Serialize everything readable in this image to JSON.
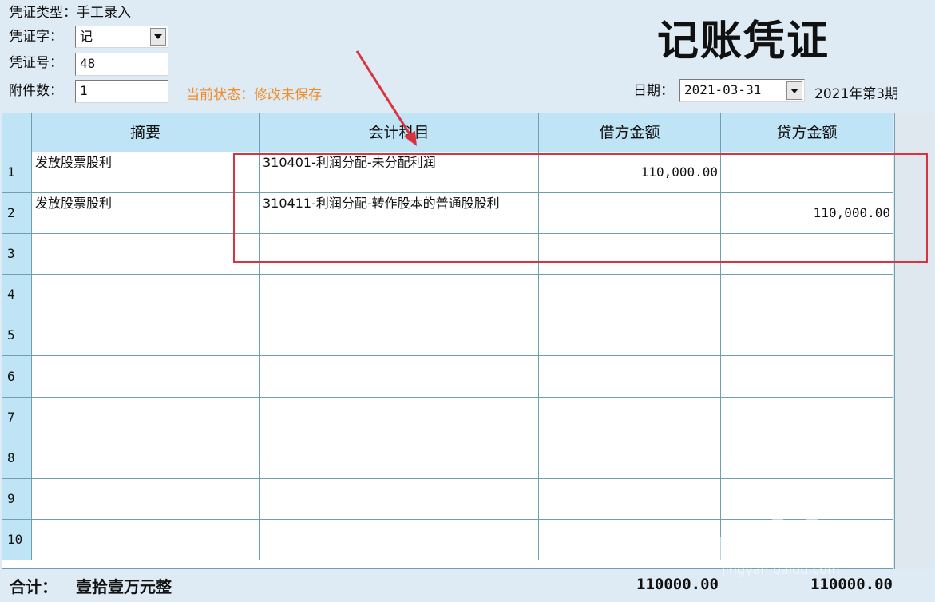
{
  "header": {
    "voucher_type_label": "凭证类型：",
    "voucher_type_value": "手工录入",
    "voucher_word_label": "凭证字：",
    "voucher_word_value": "记",
    "voucher_no_label": "凭证号：",
    "voucher_no_value": "48",
    "attachments_label": "附件数：",
    "attachments_value": "1",
    "status_text": "当前状态：修改未保存",
    "title": "记账凭证",
    "date_label": "日期：",
    "date_value": "2021-03-31",
    "period_text": "2021年第3期"
  },
  "table": {
    "columns": [
      "摘要",
      "会计科目",
      "借方金额",
      "贷方金额"
    ],
    "rows": [
      {
        "index": "1",
        "summary": "发放股票股利",
        "account": "310401-利润分配-未分配利润",
        "debit": "110,000.00",
        "credit": ""
      },
      {
        "index": "2",
        "summary": "发放股票股利",
        "account": "310411-利润分配-转作股本的普通股股利",
        "debit": "",
        "credit": "110,000.00"
      },
      {
        "index": "3",
        "summary": "",
        "account": "",
        "debit": "",
        "credit": ""
      },
      {
        "index": "4",
        "summary": "",
        "account": "",
        "debit": "",
        "credit": ""
      },
      {
        "index": "5",
        "summary": "",
        "account": "",
        "debit": "",
        "credit": ""
      },
      {
        "index": "6",
        "summary": "",
        "account": "",
        "debit": "",
        "credit": ""
      },
      {
        "index": "7",
        "summary": "",
        "account": "",
        "debit": "",
        "credit": ""
      },
      {
        "index": "8",
        "summary": "",
        "account": "",
        "debit": "",
        "credit": ""
      },
      {
        "index": "9",
        "summary": "",
        "account": "",
        "debit": "",
        "credit": ""
      },
      {
        "index": "10",
        "summary": "",
        "account": "",
        "debit": "",
        "credit": ""
      }
    ]
  },
  "totals": {
    "label": "合计：",
    "amount_in_words": "壹拾壹万元整",
    "debit_total": "110000.00",
    "credit_total": "110000.00"
  },
  "watermark": {
    "brand": "Baidu经验",
    "url": "jingyan.baidu.com"
  },
  "colors": {
    "header_bg": "#bfe4f6",
    "grid_line": "#6ea0b0",
    "status": "#f08c2a",
    "annotation": "#d9333f"
  }
}
